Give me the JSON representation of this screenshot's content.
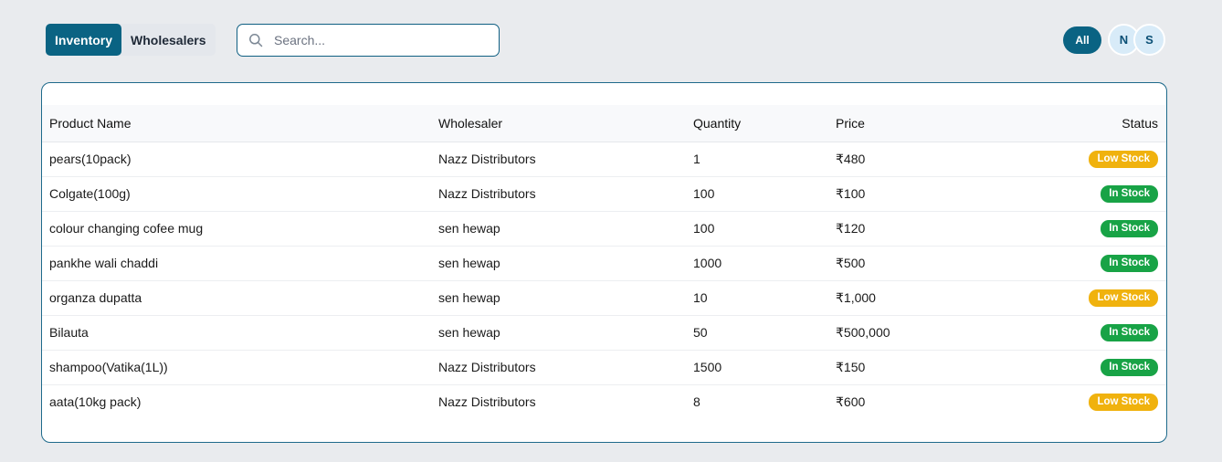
{
  "tabs": [
    {
      "label": "Inventory",
      "active": true
    },
    {
      "label": "Wholesalers",
      "active": false
    }
  ],
  "search": {
    "placeholder": "Search...",
    "value": "",
    "icon": "search-icon"
  },
  "filters": {
    "all_label": "All"
  },
  "avatars": [
    {
      "initial": "N"
    },
    {
      "initial": "S"
    }
  ],
  "table": {
    "headers": {
      "product": "Product Name",
      "wholesaler": "Wholesaler",
      "quantity": "Quantity",
      "price": "Price",
      "status": "Status"
    },
    "rows": [
      {
        "product": "pears(10pack)",
        "wholesaler": "Nazz Distributors",
        "quantity": "1",
        "price": "₹480",
        "status": "Low Stock",
        "status_type": "low"
      },
      {
        "product": "Colgate(100g)",
        "wholesaler": "Nazz Distributors",
        "quantity": "100",
        "price": "₹100",
        "status": "In Stock",
        "status_type": "in"
      },
      {
        "product": "colour changing cofee mug",
        "wholesaler": "sen hewap",
        "quantity": "100",
        "price": "₹120",
        "status": "In Stock",
        "status_type": "in"
      },
      {
        "product": "pankhe wali chaddi",
        "wholesaler": "sen hewap",
        "quantity": "1000",
        "price": "₹500",
        "status": "In Stock",
        "status_type": "in"
      },
      {
        "product": "organza dupatta",
        "wholesaler": "sen hewap",
        "quantity": "10",
        "price": "₹1,000",
        "status": "Low Stock",
        "status_type": "low"
      },
      {
        "product": "Bilauta",
        "wholesaler": "sen hewap",
        "quantity": "50",
        "price": "₹500,000",
        "status": "In Stock",
        "status_type": "in"
      },
      {
        "product": "shampoo(Vatika(1L))",
        "wholesaler": "Nazz Distributors",
        "quantity": "1500",
        "price": "₹150",
        "status": "In Stock",
        "status_type": "in"
      },
      {
        "product": "aata(10kg pack)",
        "wholesaler": "Nazz Distributors",
        "quantity": "8",
        "price": "₹600",
        "status": "Low Stock",
        "status_type": "low"
      }
    ]
  },
  "colors": {
    "accent": "#0a6383",
    "low_stock": "#f0b20e",
    "in_stock": "#18a346",
    "background": "#e9ebee"
  }
}
